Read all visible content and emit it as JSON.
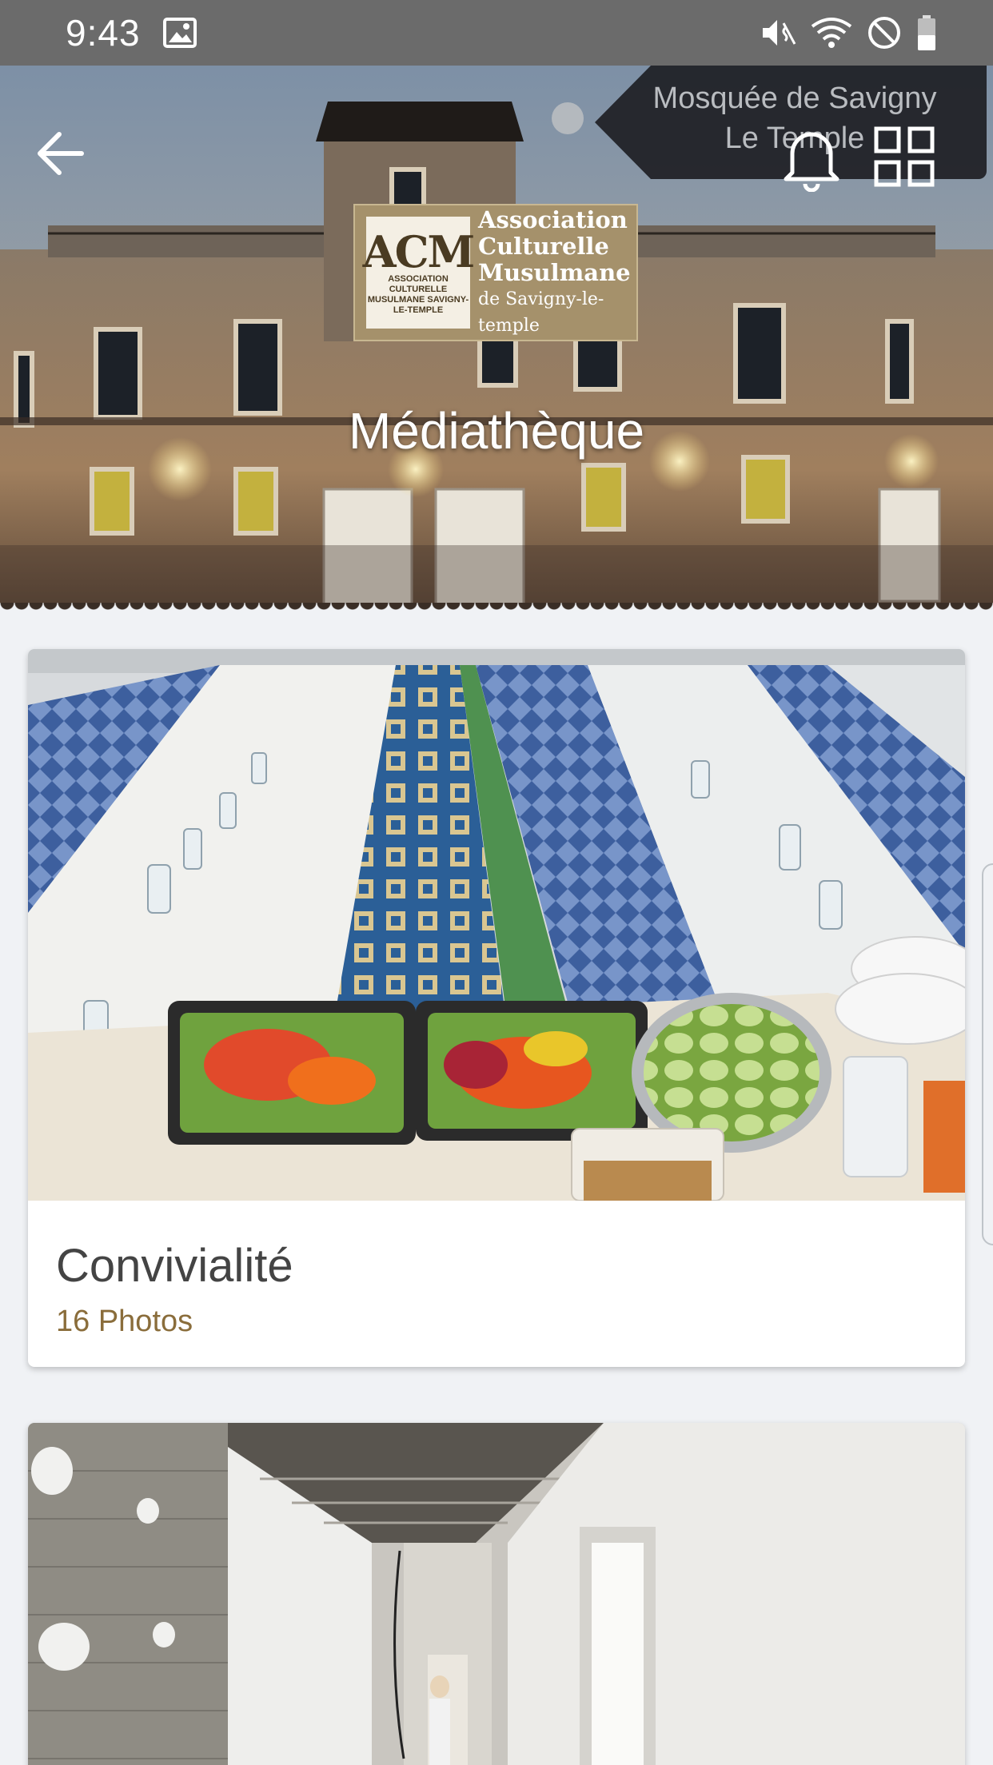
{
  "status_bar": {
    "time": "9:43",
    "icons": [
      "image-icon",
      "mute-vibrate-icon",
      "wifi-icon",
      "do-not-disturb-icon",
      "battery-icon"
    ]
  },
  "header": {
    "mosque_name": "Mosquée de Savigny Le Temple",
    "logo": {
      "mark": "ACM",
      "mark_sub": "ASSOCIATION CULTURELLE MUSULMANE SAVIGNY-LE-TEMPLE",
      "line1": "Association",
      "line2": "Culturelle",
      "line3": "Musulmane",
      "line4": "de Savigny-le-temple"
    },
    "title": "Médiathèque",
    "actions": [
      "back-arrow-icon",
      "bell-icon",
      "grid-icon"
    ]
  },
  "albums": [
    {
      "title": "Convivialité",
      "count": "16 Photos"
    },
    {
      "title": "",
      "count": ""
    }
  ],
  "colors": {
    "status_bar": "#6b6b6b",
    "background": "#f0f2f5",
    "accent_count": "#8a6d3b",
    "logo_gold": "#a5916b"
  }
}
